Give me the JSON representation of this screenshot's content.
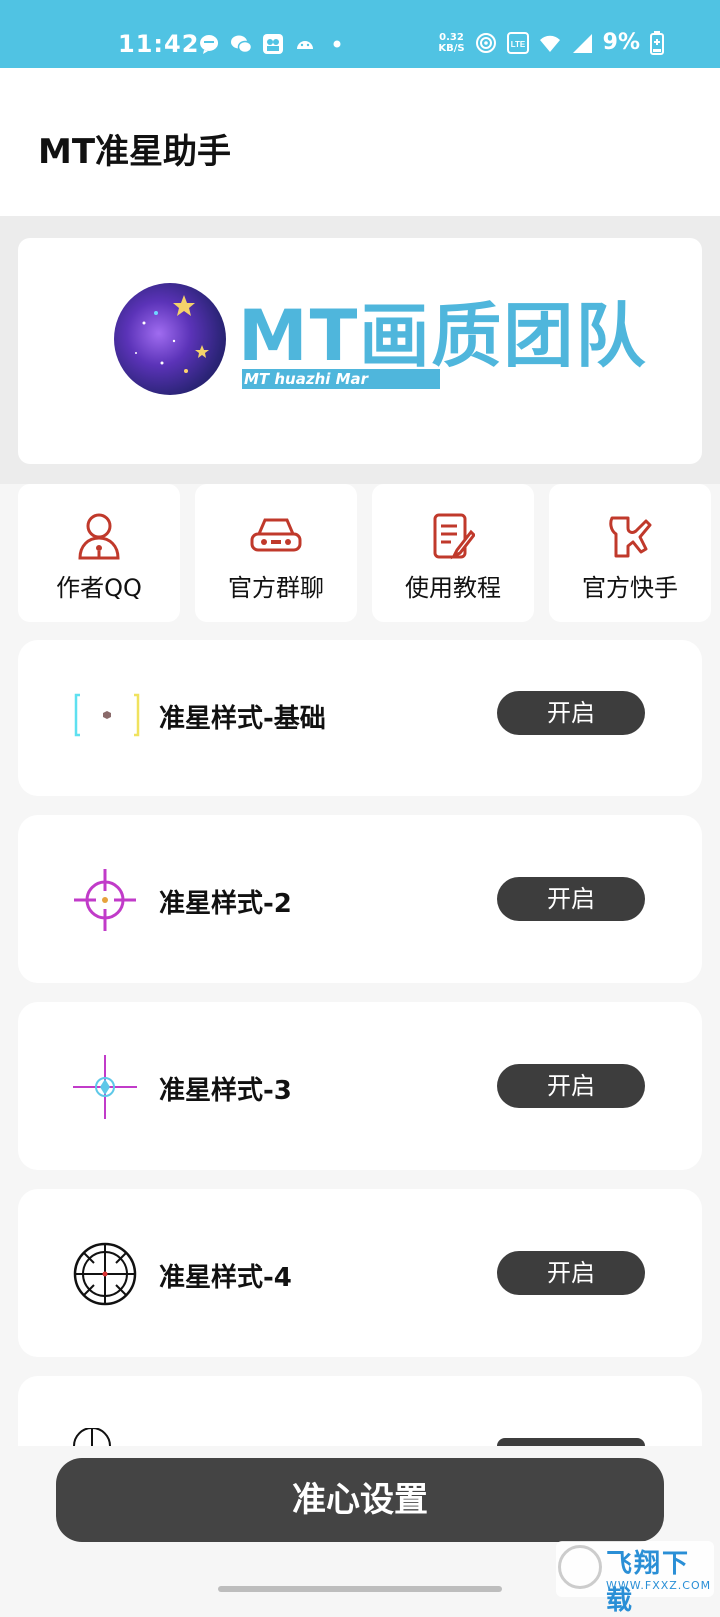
{
  "status_bar": {
    "time": "11:42",
    "net_speed_value": "0.32",
    "net_speed_unit": "KB/S",
    "battery": "9%",
    "icons": [
      "chat-bubble-icon",
      "wechat-icon",
      "video-icon",
      "android-icon",
      "dot-icon",
      "hotspot-icon",
      "volte-icon",
      "wifi-icon",
      "signal-4g-icon",
      "battery-icon"
    ]
  },
  "app_bar": {
    "title": "MT准星助手"
  },
  "banner": {
    "logo_text": "MT画质团队",
    "logo_subtext": "MT huazhi Mar"
  },
  "quick_actions": [
    {
      "label": "作者QQ",
      "icon": "user-icon"
    },
    {
      "label": "官方群聊",
      "icon": "car-icon"
    },
    {
      "label": "使用教程",
      "icon": "edit-document-icon"
    },
    {
      "label": "官方快手",
      "icon": "kuaishou-icon"
    }
  ],
  "crosshair_styles": [
    {
      "label": "准星样式-基础",
      "button": "开启",
      "icon": "crosshair-basic-icon"
    },
    {
      "label": "准星样式-2",
      "button": "开启",
      "icon": "crosshair-circle-icon"
    },
    {
      "label": "准星样式-3",
      "button": "开启",
      "icon": "crosshair-diamond-icon"
    },
    {
      "label": "准星样式-4",
      "button": "开启",
      "icon": "crosshair-scope-icon"
    }
  ],
  "bottom_button": {
    "label": "准心设置"
  },
  "watermark": {
    "text": "飞翔下载",
    "url": "WWW.FXXZ.COM"
  },
  "colors": {
    "status_bar": "#50c3e3",
    "brand_blue": "#4fb6dc",
    "button_dark": "#3d3d3d",
    "icon_red": "#c0392b"
  }
}
